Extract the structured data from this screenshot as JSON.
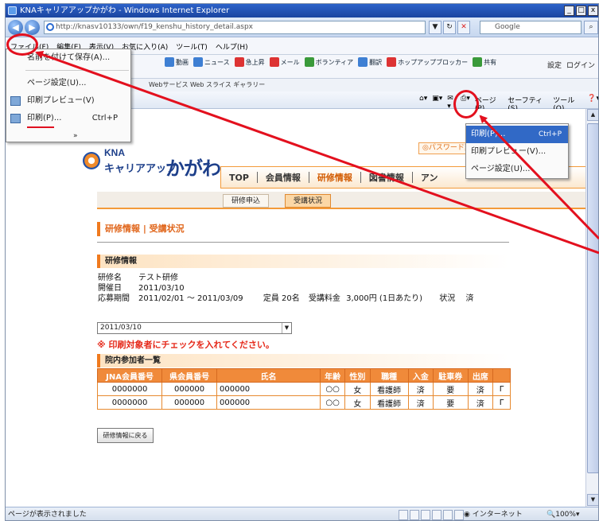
{
  "window": {
    "title": "KNAキャリアアップかがわ - Windows Internet Explorer",
    "minimize": "_",
    "maximize": "□",
    "close": "x"
  },
  "address": {
    "url": "http://knasv10133/own/f19_kenshu_history_detail.aspx",
    "search_engine": "Google"
  },
  "menu": [
    "ファイル(F)",
    "編集(E)",
    "表示(V)",
    "お気に入り(A)",
    "ツール(T)",
    "ヘルプ(H)"
  ],
  "portal_tools": [
    "動画",
    "ニュース",
    "急上昇",
    "メール",
    "ボランティア",
    "翻訳",
    "ホップアップブロッカー",
    "共有"
  ],
  "login_tools": [
    "設定",
    "ログイン"
  ],
  "favorites": "Webサービス  Web スライス ギャラリー",
  "command_bar": [
    "ページ(P)",
    "セーフティ(S)",
    "ツール(O)"
  ],
  "file_menu": {
    "items": [
      {
        "label": "名前を付けて保存(A)..."
      },
      {
        "label": "ページ設定(U)..."
      },
      {
        "label": "印刷プレビュー(V)"
      },
      {
        "label": "印刷(P)...",
        "shortcut": "Ctrl+P"
      }
    ],
    "more": "»"
  },
  "print_menu": {
    "items": [
      {
        "label": "印刷(P)...",
        "shortcut": "Ctrl+P"
      },
      {
        "label": "印刷プレビュー(V)..."
      },
      {
        "label": "ページ設定(U)..."
      }
    ]
  },
  "site": {
    "logo_kna": "KNA",
    "logo_career": "キャリアアップ",
    "logo_kagawa": "かがわ",
    "password_button": "◎パスワード変更",
    "nav": [
      "TOP",
      "会員情報",
      "研修情報",
      "図書情報",
      "アン"
    ],
    "subnav": [
      "研修申込",
      "受講状況"
    ]
  },
  "page": {
    "heading": "研修情報 | 受講状況",
    "section_info": "研修情報",
    "info": {
      "name_label": "研修名",
      "name_value": "テスト研修",
      "date_label": "開催日",
      "date_value": "2011/03/10",
      "period_label": "応募期間",
      "period_value": "2011/02/01 ～ 2011/03/09",
      "capacity": "定員 20名",
      "fee_label": "受講料金",
      "fee_value": "3,000円 (1日あたり)",
      "status_label": "状況",
      "status_value": "済"
    },
    "date_select": "2011/03/10",
    "warning": "※ 印刷対象者にチェックを入れてください。",
    "section_participants": "院内参加者一覧",
    "table": {
      "headers": [
        "JNA会員番号",
        "県会員番号",
        "氏名",
        "年齢",
        "性別",
        "職種",
        "入金",
        "駐車券",
        "出席",
        ""
      ],
      "rows": [
        [
          "0000000",
          "000000",
          "000000",
          "○○",
          "女",
          "看護師",
          "済",
          "要",
          "済",
          "Γ"
        ],
        [
          "0000000",
          "000000",
          "000000",
          "○○",
          "女",
          "看護師",
          "済",
          "要",
          "済",
          "Γ"
        ]
      ]
    },
    "back_button": "研修情報に戻る"
  },
  "status": {
    "text": "ページが表示されました",
    "zone": "インターネット",
    "zoom": "100%"
  },
  "colors": {
    "accent": "#f07a1e",
    "annotation": "#e3101e",
    "brand": "#1d3f8a"
  }
}
